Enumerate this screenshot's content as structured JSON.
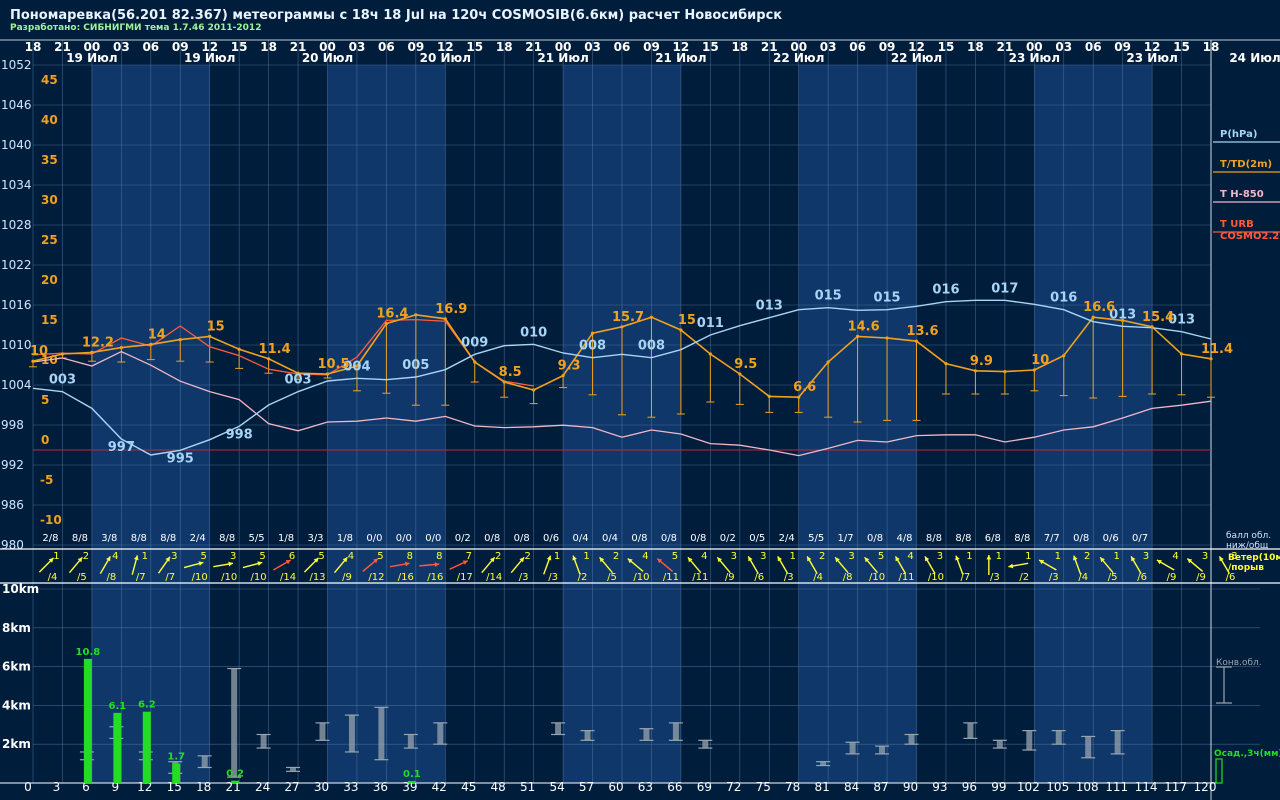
{
  "header": {
    "title": "Пономаревка(56.201 82.367) метеограммы с  18ч 18 Jul на 120ч COSMOSIB(6.6км) расчет Новосибирск",
    "subtitle": "Разработано: СИБНИГМИ тема 1.7.46 2011-2012"
  },
  "colors": {
    "background": "#001d3c",
    "band_light": "#0f3769",
    "pressure": "#a8d4f5",
    "temperature": "#f0a21e",
    "t850": "#f2b6c8",
    "urb": "#ff5a3c",
    "zero_line": "#b03030",
    "wind": "#ffff33",
    "precip": "#22dd22",
    "cloud": "#9aa4ae",
    "grid": "#5b7fa8"
  },
  "chart_data": {
    "type": "meteogram",
    "x_hours": [
      0,
      3,
      6,
      9,
      12,
      15,
      18,
      21,
      24,
      27,
      30,
      33,
      36,
      39,
      42,
      45,
      48,
      51,
      54,
      57,
      60,
      63,
      66,
      69,
      72,
      75,
      78,
      81,
      84,
      87,
      90,
      93,
      96,
      99,
      102,
      105,
      108,
      111,
      114,
      117,
      120
    ],
    "top_hour_labels": [
      "18",
      "21",
      "00",
      "03",
      "06",
      "09",
      "12",
      "15",
      "18",
      "21",
      "00",
      "03",
      "06",
      "09",
      "12",
      "15",
      "18",
      "21",
      "00",
      "03",
      "06",
      "09",
      "12",
      "15",
      "18",
      "21",
      "00",
      "03",
      "06",
      "09",
      "12",
      "15",
      "18",
      "21",
      "00",
      "03",
      "06",
      "09",
      "12",
      "15",
      "18"
    ],
    "day_labels": [
      {
        "hour": 6,
        "text": "19 Июл"
      },
      {
        "hour": 18,
        "text": "19 Июл"
      },
      {
        "hour": 30,
        "text": "20 Июл"
      },
      {
        "hour": 42,
        "text": "20 Июл"
      },
      {
        "hour": 54,
        "text": "21 Июл"
      },
      {
        "hour": 66,
        "text": "21 Июл"
      },
      {
        "hour": 78,
        "text": "22 Июл"
      },
      {
        "hour": 90,
        "text": "22 Июл"
      },
      {
        "hour": 102,
        "text": "23 Июл"
      },
      {
        "hour": 114,
        "text": "23 Июл"
      },
      {
        "hour": 126,
        "text": "24 Июл"
      }
    ],
    "night_bands": [
      [
        6,
        18
      ],
      [
        30,
        42
      ],
      [
        54,
        66
      ],
      [
        78,
        90
      ],
      [
        102,
        114
      ]
    ],
    "pressure_axis": {
      "ticks": [
        1052,
        1046,
        1040,
        1034,
        1028,
        1022,
        1016,
        1010,
        1004,
        998,
        992,
        986,
        980
      ],
      "ylim": [
        980,
        1052
      ]
    },
    "temperature_axis": {
      "ticks": [
        45,
        40,
        35,
        30,
        25,
        20,
        15,
        10,
        5,
        0,
        -5,
        -10
      ],
      "ylim": [
        -12.5,
        47.5
      ]
    },
    "pressure": [
      1003.5,
      1003.0,
      1000.5,
      995.9,
      993.5,
      994.2,
      995.8,
      997.8,
      1001.0,
      1003.0,
      1004.6,
      1005.0,
      1004.8,
      1005.2,
      1006.3,
      1008.6,
      1009.9,
      1010.1,
      1008.8,
      1008.1,
      1008.6,
      1008.1,
      1009.3,
      1011.5,
      1012.9,
      1014.1,
      1015.3,
      1015.6,
      1015.2,
      1015.3,
      1015.8,
      1016.5,
      1016.7,
      1016.7,
      1016.1,
      1015.3,
      1013.5,
      1012.8,
      1012.6,
      1012.0,
      1010.9
    ],
    "pressure_labels": [
      {
        "hour": 3,
        "text": "003"
      },
      {
        "hour": 9,
        "text": "997"
      },
      {
        "hour": 15,
        "text": "995"
      },
      {
        "hour": 21,
        "text": "998"
      },
      {
        "hour": 27,
        "text": "003"
      },
      {
        "hour": 33,
        "text": "004"
      },
      {
        "hour": 39,
        "text": "005"
      },
      {
        "hour": 45,
        "text": "009"
      },
      {
        "hour": 51,
        "text": "010"
      },
      {
        "hour": 57,
        "text": "008"
      },
      {
        "hour": 63,
        "text": "008"
      },
      {
        "hour": 69,
        "text": "011"
      },
      {
        "hour": 75,
        "text": "013"
      },
      {
        "hour": 81,
        "text": "015"
      },
      {
        "hour": 87,
        "text": "015"
      },
      {
        "hour": 93,
        "text": "016"
      },
      {
        "hour": 99,
        "text": "017"
      },
      {
        "hour": 105,
        "text": "016"
      },
      {
        "hour": 111,
        "text": "013"
      },
      {
        "hour": 117,
        "text": "013"
      }
    ],
    "temperature": [
      11.1,
      12.0,
      12.2,
      12.8,
      13.2,
      13.8,
      14.2,
      12.6,
      11.4,
      9.6,
      9.5,
      10.5,
      15.8,
      16.9,
      16.4,
      11.0,
      8.5,
      7.5,
      9.3,
      14.6,
      15.4,
      16.6,
      15.0,
      12.0,
      9.5,
      6.7,
      6.6,
      11.0,
      14.2,
      14.0,
      13.6,
      10.8,
      9.9,
      9.8,
      10.0,
      11.8,
      16.6,
      16.2,
      15.4,
      12.0,
      11.4
    ],
    "dewpoint": [
      10.4,
      11.5,
      11.1,
      11.0,
      11.3,
      11.1,
      11.0,
      10.2,
      9.6,
      8.8,
      9.0,
      7.4,
      7.1,
      5.6,
      5.6,
      8.5,
      6.6,
      5.8,
      7.8,
      6.9,
      4.4,
      4.1,
      4.5,
      6.0,
      5.7,
      4.7,
      4.7,
      4.1,
      3.5,
      3.7,
      3.7,
      7.0,
      7.0,
      7.0,
      7.4,
      6.8,
      6.5,
      6.7,
      7.0,
      6.9,
      6.6
    ],
    "t850": [
      11.0,
      11.5,
      10.5,
      12.3,
      10.6,
      8.6,
      7.3,
      6.3,
      3.3,
      2.4,
      3.5,
      3.6,
      4.0,
      3.6,
      4.2,
      3.0,
      2.8,
      2.9,
      3.1,
      2.8,
      1.6,
      2.5,
      2.0,
      0.8,
      0.6,
      0.0,
      -0.7,
      0.2,
      1.2,
      1.0,
      1.8,
      1.9,
      1.9,
      1.0,
      1.6,
      2.5,
      2.9,
      4.0,
      5.2,
      5.6,
      6.1
    ],
    "t_urb": [
      11.9,
      12.1,
      12.0,
      14.0,
      13.0,
      15.5,
      12.9,
      11.8,
      10.1,
      9.5,
      9.4,
      11.6,
      16.2,
      16.3,
      16.1,
      11.0,
      8.6,
      8.0,
      null,
      null,
      null,
      null,
      null,
      null,
      null,
      null,
      null,
      null,
      null,
      null,
      null,
      null,
      null,
      null,
      null,
      null,
      null,
      null,
      null,
      null,
      null
    ],
    "temperature_labels": [
      {
        "hour": 0,
        "text": "10"
      },
      {
        "hour": 6,
        "text": "12.2"
      },
      {
        "hour": 12,
        "text": "14"
      },
      {
        "hour": 18,
        "text": "15"
      },
      {
        "hour": 24,
        "text": "11.4"
      },
      {
        "hour": 30,
        "text": "10.5"
      },
      {
        "hour": 36,
        "text": "16.4"
      },
      {
        "hour": 42,
        "text": "16.9"
      },
      {
        "hour": 48,
        "text": "8.5"
      },
      {
        "hour": 54,
        "text": "9.3"
      },
      {
        "hour": 60,
        "text": "15.7"
      },
      {
        "hour": 66,
        "text": "15"
      },
      {
        "hour": 72,
        "text": "9.5"
      },
      {
        "hour": 78,
        "text": "6.6"
      },
      {
        "hour": 84,
        "text": "14.6"
      },
      {
        "hour": 90,
        "text": "13.6"
      },
      {
        "hour": 96,
        "text": "9.9"
      },
      {
        "hour": 102,
        "text": "10"
      },
      {
        "hour": 108,
        "text": "16.6"
      },
      {
        "hour": 114,
        "text": "15.4"
      },
      {
        "hour": 120,
        "text": "11.4"
      }
    ],
    "cloud_cover": [
      "2/8",
      "8/8",
      "3/8",
      "8/8",
      "8/8",
      "2/4",
      "8/8",
      "5/5",
      "1/8",
      "3/3",
      "1/8",
      "0/0",
      "0/0",
      "0/0",
      "0/2",
      "0/8",
      "0/8",
      "0/6",
      "0/4",
      "0/4",
      "0/8",
      "0/8",
      "0/8",
      "0/2",
      "0/5",
      "2/4",
      "5/5",
      "1/7",
      "0/8",
      "4/8",
      "8/8",
      "8/8",
      "6/8",
      "8/8",
      "7/7",
      "0/8",
      "0/6",
      "0/7"
    ],
    "wind": [
      {
        "h": 3,
        "dir": 45,
        "s": 1,
        "g": 4,
        "red": false
      },
      {
        "h": 6,
        "dir": 40,
        "s": 2,
        "g": 5,
        "red": false
      },
      {
        "h": 9,
        "dir": 30,
        "s": 4,
        "g": 8,
        "red": false
      },
      {
        "h": 12,
        "dir": 15,
        "s": 1,
        "g": 7,
        "red": false
      },
      {
        "h": 15,
        "dir": 35,
        "s": 3,
        "g": 7,
        "red": false
      },
      {
        "h": 18,
        "dir": 75,
        "s": 5,
        "g": 10,
        "red": false
      },
      {
        "h": 21,
        "dir": 80,
        "s": 3,
        "g": 10,
        "red": false
      },
      {
        "h": 24,
        "dir": 75,
        "s": 5,
        "g": 10,
        "red": false
      },
      {
        "h": 27,
        "dir": 60,
        "s": 6,
        "g": 14,
        "red": true
      },
      {
        "h": 30,
        "dir": 45,
        "s": 5,
        "g": 13,
        "red": false
      },
      {
        "h": 33,
        "dir": 40,
        "s": 4,
        "g": 9,
        "red": false
      },
      {
        "h": 36,
        "dir": 50,
        "s": 5,
        "g": 12,
        "red": true
      },
      {
        "h": 39,
        "dir": 80,
        "s": 8,
        "g": 16,
        "red": true
      },
      {
        "h": 42,
        "dir": 85,
        "s": 8,
        "g": 16,
        "red": true
      },
      {
        "h": 45,
        "dir": 65,
        "s": 7,
        "g": 17,
        "red": true
      },
      {
        "h": 48,
        "dir": 40,
        "s": 2,
        "g": 14,
        "red": false
      },
      {
        "h": 51,
        "dir": 40,
        "s": 2,
        "g": 3,
        "red": false
      },
      {
        "h": 54,
        "dir": 20,
        "s": 1,
        "g": 3,
        "red": false
      },
      {
        "h": 57,
        "dir": 340,
        "s": 1,
        "g": 2,
        "red": false
      },
      {
        "h": 60,
        "dir": 320,
        "s": 2,
        "g": 5,
        "red": false
      },
      {
        "h": 63,
        "dir": 310,
        "s": 4,
        "g": 10,
        "red": false
      },
      {
        "h": 66,
        "dir": 310,
        "s": 5,
        "g": 11,
        "red": true
      },
      {
        "h": 69,
        "dir": 320,
        "s": 4,
        "g": 11,
        "red": false
      },
      {
        "h": 72,
        "dir": 320,
        "s": 3,
        "g": 9,
        "red": false
      },
      {
        "h": 75,
        "dir": 330,
        "s": 3,
        "g": 6,
        "red": false
      },
      {
        "h": 78,
        "dir": 330,
        "s": 1,
        "g": 3,
        "red": false
      },
      {
        "h": 81,
        "dir": 330,
        "s": 2,
        "g": 4,
        "red": false
      },
      {
        "h": 84,
        "dir": 320,
        "s": 3,
        "g": 8,
        "red": false
      },
      {
        "h": 87,
        "dir": 320,
        "s": 5,
        "g": 10,
        "red": false
      },
      {
        "h": 90,
        "dir": 330,
        "s": 4,
        "g": 11,
        "red": false
      },
      {
        "h": 93,
        "dir": 330,
        "s": 3,
        "g": 10,
        "red": false
      },
      {
        "h": 96,
        "dir": 340,
        "s": 1,
        "g": 7,
        "red": false
      },
      {
        "h": 99,
        "dir": 0,
        "s": 1,
        "g": 3,
        "red": false
      },
      {
        "h": 102,
        "dir": 260,
        "s": 1,
        "g": 2,
        "red": false
      },
      {
        "h": 105,
        "dir": 300,
        "s": 1,
        "g": 3,
        "red": false
      },
      {
        "h": 108,
        "dir": 340,
        "s": 2,
        "g": 4,
        "red": false
      },
      {
        "h": 111,
        "dir": 320,
        "s": 1,
        "g": 5,
        "red": false
      },
      {
        "h": 114,
        "dir": 330,
        "s": 3,
        "g": 6,
        "red": false
      },
      {
        "h": 117,
        "dir": 300,
        "s": 4,
        "g": 9,
        "red": false
      },
      {
        "h": 120,
        "dir": 310,
        "s": 3,
        "g": 9,
        "red": false
      },
      {
        "h": 123,
        "dir": 330,
        "s": 3,
        "g": 6,
        "red": false
      }
    ],
    "height_axis": {
      "ticks": [
        "10km",
        "8km",
        "6km",
        "4km",
        "2km"
      ],
      "values": [
        10,
        8,
        6,
        4,
        2
      ]
    },
    "hour_axis_labels": [
      "0",
      "3",
      "6",
      "9",
      "12",
      "15",
      "18",
      "21",
      "24",
      "27",
      "30",
      "33",
      "36",
      "39",
      "42",
      "45",
      "48",
      "51",
      "54",
      "57",
      "60",
      "63",
      "66",
      "69",
      "72",
      "75",
      "78",
      "81",
      "84",
      "87",
      "90",
      "93",
      "96",
      "99",
      "102",
      "105",
      "108",
      "111",
      "114",
      "117",
      "120"
    ],
    "precip": [
      {
        "hour": 6,
        "mm": 10.8,
        "label": "10.8"
      },
      {
        "hour": 9,
        "mm": 6.1,
        "label": "6.1"
      },
      {
        "hour": 12,
        "mm": 6.2,
        "label": "6.2"
      },
      {
        "hour": 15,
        "mm": 1.7,
        "label": "1.7"
      },
      {
        "hour": 21,
        "mm": 0.2,
        "label": "0.2"
      },
      {
        "hour": 39,
        "mm": 0.1,
        "label": "0.1"
      }
    ],
    "conv_clouds": [
      {
        "hour": 6,
        "base": 1.2,
        "top": 1.6
      },
      {
        "hour": 9,
        "base": 2.3,
        "top": 2.9
      },
      {
        "hour": 12,
        "base": 1.2,
        "top": 1.6
      },
      {
        "hour": 15,
        "base": 0.5,
        "top": 1.1
      },
      {
        "hour": 18,
        "base": 0.8,
        "top": 1.4
      },
      {
        "hour": 21,
        "base": 0.3,
        "top": 5.9
      },
      {
        "hour": 24,
        "base": 1.8,
        "top": 2.5
      },
      {
        "hour": 27,
        "base": 0.6,
        "top": 0.8
      },
      {
        "hour": 30,
        "base": 2.2,
        "top": 3.1
      },
      {
        "hour": 33,
        "base": 1.6,
        "top": 3.5
      },
      {
        "hour": 36,
        "base": 1.2,
        "top": 3.9
      },
      {
        "hour": 39,
        "base": 1.8,
        "top": 2.5
      },
      {
        "hour": 42,
        "base": 2.0,
        "top": 3.1
      },
      {
        "hour": 54,
        "base": 2.5,
        "top": 3.1
      },
      {
        "hour": 57,
        "base": 2.2,
        "top": 2.7
      },
      {
        "hour": 63,
        "base": 2.2,
        "top": 2.8
      },
      {
        "hour": 66,
        "base": 2.2,
        "top": 3.1
      },
      {
        "hour": 69,
        "base": 1.8,
        "top": 2.2
      },
      {
        "hour": 81,
        "base": 0.9,
        "top": 1.1
      },
      {
        "hour": 84,
        "base": 1.5,
        "top": 2.1
      },
      {
        "hour": 87,
        "base": 1.5,
        "top": 1.9
      },
      {
        "hour": 90,
        "base": 2.0,
        "top": 2.5
      },
      {
        "hour": 96,
        "base": 2.3,
        "top": 3.1
      },
      {
        "hour": 99,
        "base": 1.8,
        "top": 2.2
      },
      {
        "hour": 102,
        "base": 1.7,
        "top": 2.7
      },
      {
        "hour": 105,
        "base": 2.0,
        "top": 2.7
      },
      {
        "hour": 108,
        "base": 1.3,
        "top": 2.4
      },
      {
        "hour": 111,
        "base": 1.5,
        "top": 2.7
      }
    ],
    "legend": {
      "pressure": "P(hPa)",
      "temperature": "T/TD(2m)",
      "t850": "T H-850",
      "urb": "T URB",
      "cosmo": "COSMO2.2",
      "cloud_line1": "балл обл.",
      "cloud_line2": "ниж/общ",
      "wind_line1": "Ветер(10м)",
      "wind_line2": "/порыв",
      "conv": "Конв.обл.",
      "precip": "Осад.,3ч(мм)"
    }
  }
}
